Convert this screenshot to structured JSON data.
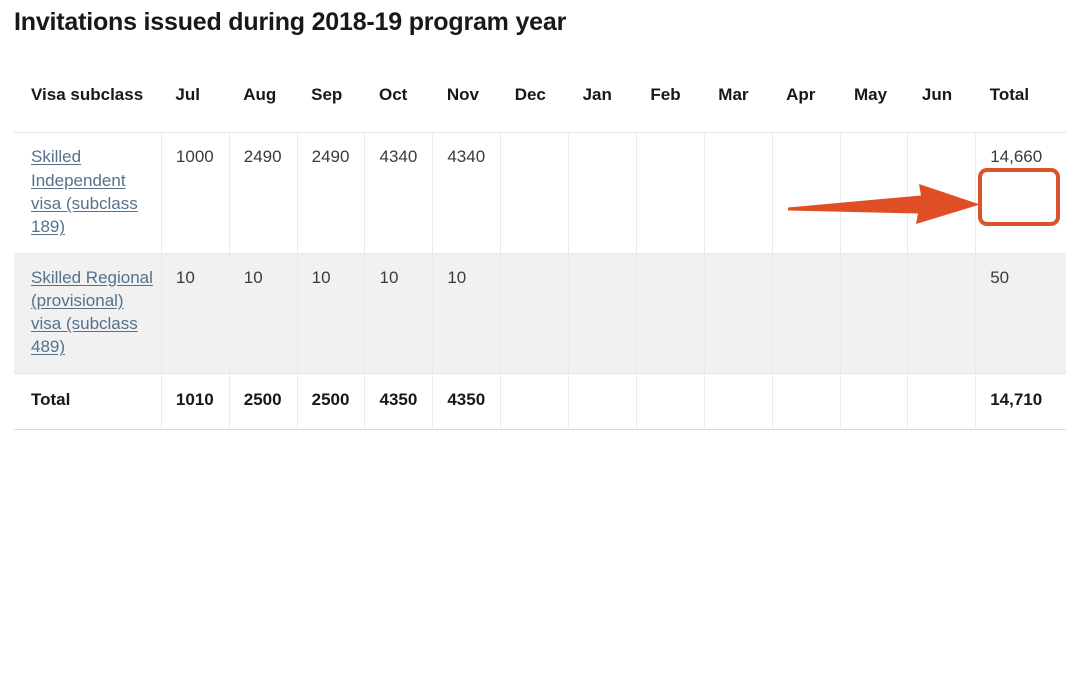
{
  "page": {
    "title": "Invitations issued during 2018-19 program year"
  },
  "table": {
    "columns": [
      {
        "key": "visa",
        "label": "Visa subclass"
      },
      {
        "key": "jul",
        "label": "Jul"
      },
      {
        "key": "aug",
        "label": "Aug"
      },
      {
        "key": "sep",
        "label": "Sep"
      },
      {
        "key": "oct",
        "label": "Oct"
      },
      {
        "key": "nov",
        "label": "Nov"
      },
      {
        "key": "dec",
        "label": "Dec"
      },
      {
        "key": "jan",
        "label": "Jan"
      },
      {
        "key": "feb",
        "label": "Feb"
      },
      {
        "key": "mar",
        "label": "Mar"
      },
      {
        "key": "apr",
        "label": "Apr"
      },
      {
        "key": "may",
        "label": "May"
      },
      {
        "key": "jun",
        "label": "Jun"
      },
      {
        "key": "total",
        "label": "Total"
      }
    ],
    "rows": [
      {
        "label": "Skilled Independent visa (subclass 189)",
        "is_link": true,
        "values": [
          "1000",
          "2490",
          "2490",
          "4340",
          "4340",
          "",
          "",
          "",
          "",
          "",
          "",
          "",
          "14,660"
        ]
      },
      {
        "label": "Skilled Regional (provisional) visa (subclass 489)",
        "is_link": true,
        "values": [
          "10",
          "10",
          "10",
          "10",
          "10",
          "",
          "",
          "",
          "",
          "",
          "",
          "",
          "50"
        ]
      },
      {
        "label": "Total",
        "is_link": false,
        "values": [
          "1010",
          "2500",
          "2500",
          "4350",
          "4350",
          "",
          "",
          "",
          "",
          "",
          "",
          "",
          "14,710"
        ]
      }
    ]
  },
  "annotation": {
    "highlighted_value": "14,660",
    "arrow_color": "#e04e26",
    "box_color": "#d9532c"
  },
  "colors": {
    "link": "#55718c",
    "text": "#16191c",
    "row_alt_background": "#f1f1f2"
  }
}
